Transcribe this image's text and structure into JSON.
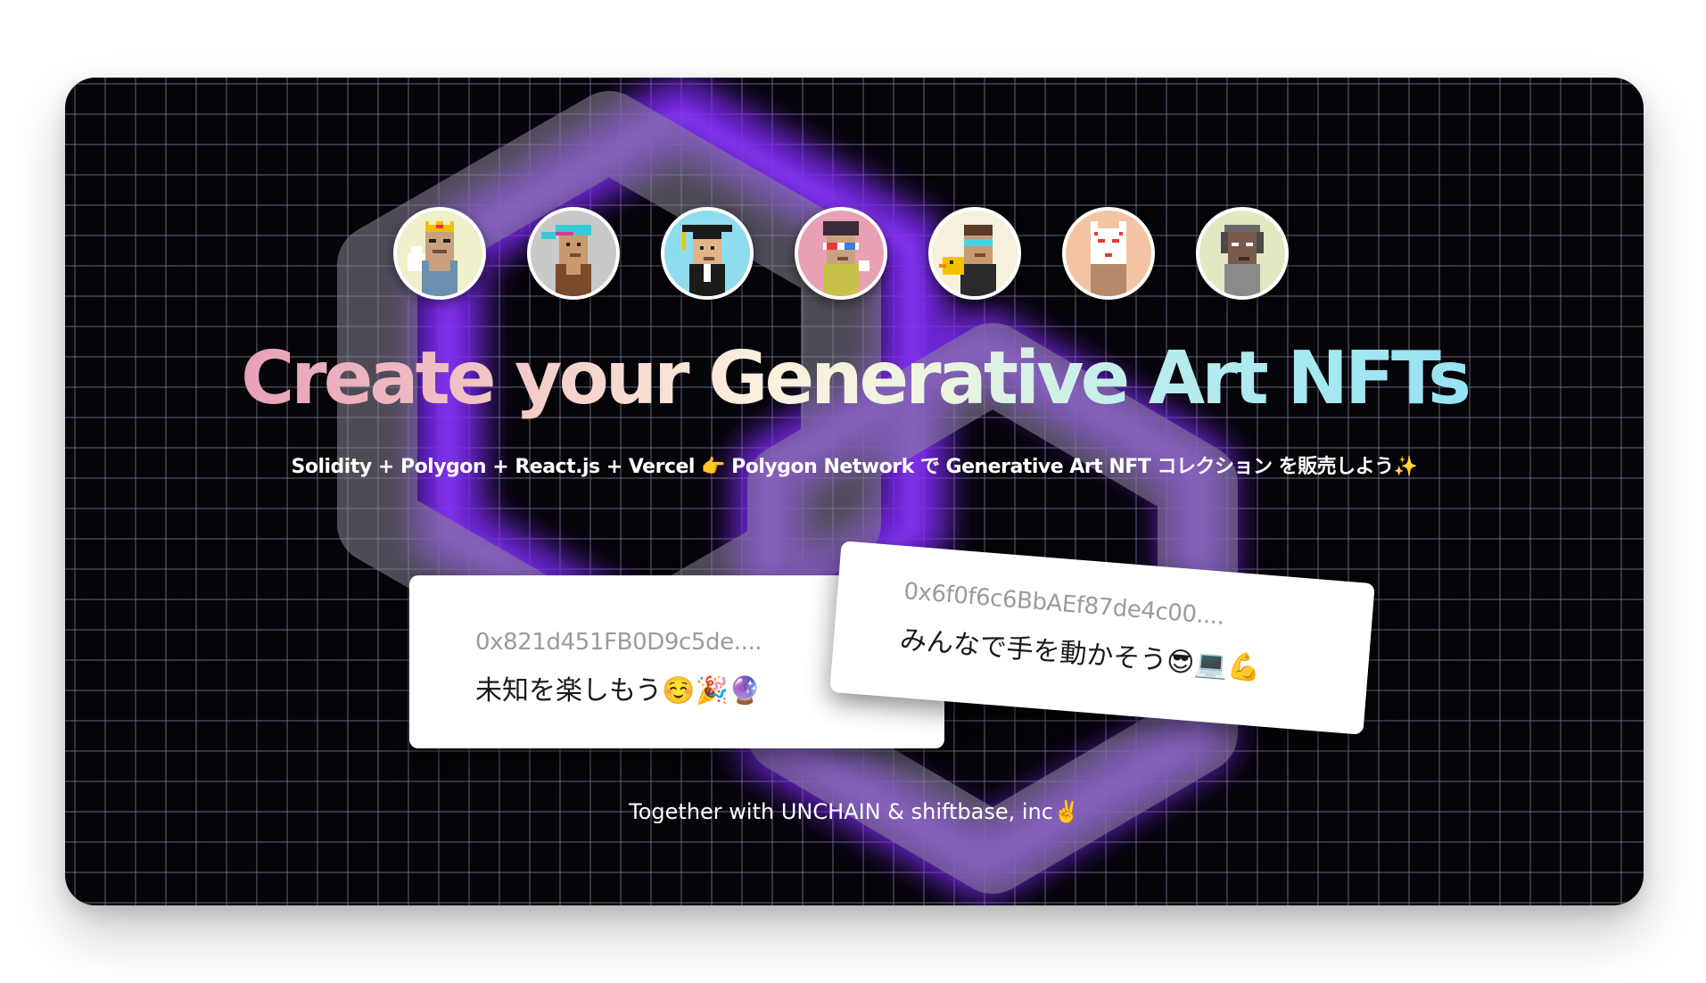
{
  "headline": "Create your Generative Art NFTs",
  "subtitle": "Solidity + Polygon + React.js + Vercel 👉 Polygon Network で Generative Art NFT コレクション を販売しよう✨",
  "messages": [
    {
      "address": "0x821d451FB0D9c5de....",
      "text": "未知を楽しもう☺️🎉🔮"
    },
    {
      "address": "0x6f0f6c6BbAEf87de4c00....",
      "text": "みんなで手を動かそう😎💻💪"
    }
  ],
  "footer": "Together with UNCHAIN & shiftbase, inc✌️",
  "colors": {
    "background": "#050408",
    "grid": "#787696",
    "logo_glow": "#7b2cf0",
    "headline_gradient": [
      "#e7a1b7",
      "#fbefdd",
      "#96e3f3"
    ]
  },
  "avatars": [
    {
      "name": "crowned-character-avatar",
      "bg": "#efefc9"
    },
    {
      "name": "cap-character-avatar",
      "bg": "#c9c9c9"
    },
    {
      "name": "graduate-character-avatar",
      "bg": "#8fdcef"
    },
    {
      "name": "3d-glasses-character-avatar",
      "bg": "#e8a0b4"
    },
    {
      "name": "duck-character-avatar",
      "bg": "#f5f1dc"
    },
    {
      "name": "fox-mask-character-avatar",
      "bg": "#f3c4a4"
    },
    {
      "name": "headset-character-avatar",
      "bg": "#e4e8c2"
    }
  ]
}
